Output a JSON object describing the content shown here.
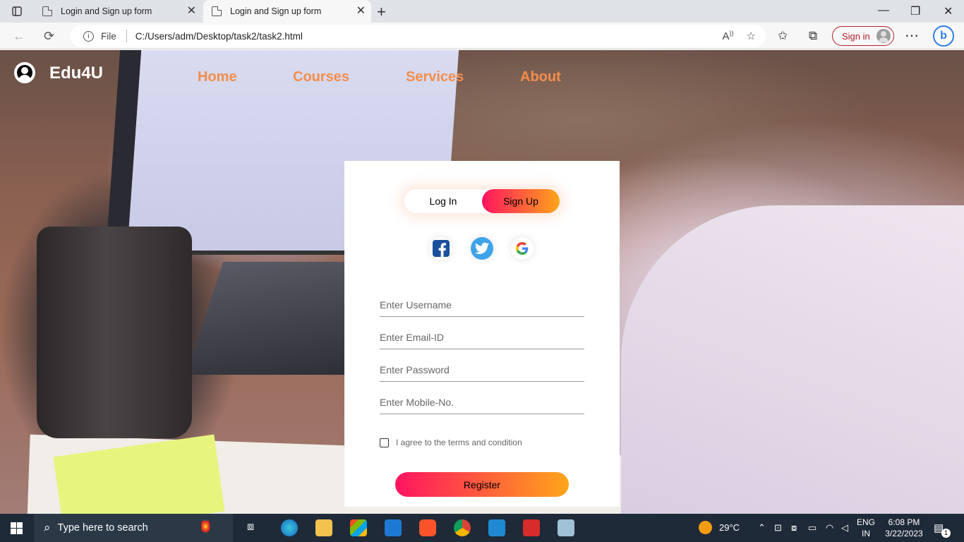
{
  "browser": {
    "tabs": [
      {
        "title": "Login and Sign up form"
      },
      {
        "title": "Login and Sign up form"
      }
    ],
    "address": {
      "scheme_label": "File",
      "url": "C:/Users/adm/Desktop/task2/task2.html"
    },
    "signin_label": "Sign in"
  },
  "site": {
    "brand": "Edu4U",
    "nav": [
      {
        "label": "Home"
      },
      {
        "label": "Courses"
      },
      {
        "label": "Services"
      },
      {
        "label": "About"
      }
    ],
    "accent_color": "#f58d4a"
  },
  "form": {
    "toggle": {
      "login": "Log In",
      "signup": "Sign Up"
    },
    "social": [
      "facebook-icon",
      "twitter-icon",
      "google-icon"
    ],
    "fields": [
      {
        "name": "username",
        "placeholder": "Enter Username"
      },
      {
        "name": "email",
        "placeholder": "Enter Email-ID"
      },
      {
        "name": "password",
        "placeholder": "Enter Password"
      },
      {
        "name": "mobile",
        "placeholder": "Enter Mobile-No."
      }
    ],
    "terms_label": "I agree to the terms and condition",
    "submit_label": "Register",
    "gradient": [
      "#ff1460",
      "#ffa51a"
    ]
  },
  "taskbar": {
    "search_placeholder": "Type here to search",
    "weather": "29°C",
    "language": "ENG",
    "region": "IN",
    "time": "6:08 PM",
    "date": "3/22/2023",
    "notification_count": "1"
  }
}
